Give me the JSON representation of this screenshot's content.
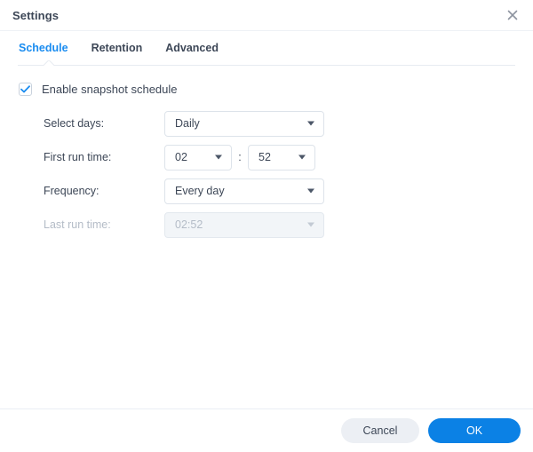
{
  "window": {
    "title": "Settings",
    "close_icon": "close-icon"
  },
  "tabs": [
    {
      "label": "Schedule",
      "active": true
    },
    {
      "label": "Retention",
      "active": false
    },
    {
      "label": "Advanced",
      "active": false
    }
  ],
  "enable_schedule": {
    "label": "Enable snapshot schedule",
    "checked": true
  },
  "form": {
    "select_days": {
      "label": "Select days:",
      "value": "Daily",
      "disabled": false
    },
    "first_run_time": {
      "label": "First run time:",
      "hour": "02",
      "minute": "52",
      "separator": ":",
      "disabled": false
    },
    "frequency": {
      "label": "Frequency:",
      "value": "Every day",
      "disabled": false
    },
    "last_run_time": {
      "label": "Last run time:",
      "value": "02:52",
      "disabled": true
    }
  },
  "footer": {
    "cancel_label": "Cancel",
    "ok_label": "OK"
  },
  "colors": {
    "accent": "#1a8cf0",
    "primary_button": "#0b81e5",
    "text": "#3d4757",
    "muted_text": "#b4bcc7",
    "border": "#dde3ea"
  }
}
